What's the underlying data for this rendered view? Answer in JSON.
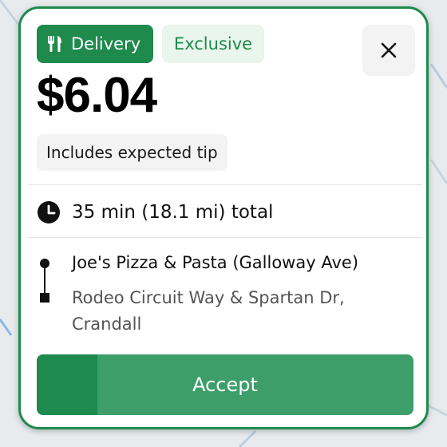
{
  "offer": {
    "badge_delivery": "Delivery",
    "badge_exclusive": "Exclusive",
    "price": "$6.04",
    "tip_note": "Includes expected tip",
    "duration": "35 min (18.1 mi) total",
    "pickup": "Joe's Pizza & Pasta (Galloway Ave)",
    "dropoff": "Rodeo Circuit Way & Spartan Dr, Crandall",
    "accept_label": "Accept",
    "accept_countdown_progress": 0.16
  },
  "icons": {
    "delivery": "utensils-icon",
    "close": "close-icon",
    "time": "clock-icon",
    "route": "route-line-icon"
  },
  "colors": {
    "brand_green": "#1e8a4c",
    "accept_button": "#3d9e6a",
    "accept_progress": "#1f8a4d",
    "exclusive_bg": "#e9f5ed"
  }
}
